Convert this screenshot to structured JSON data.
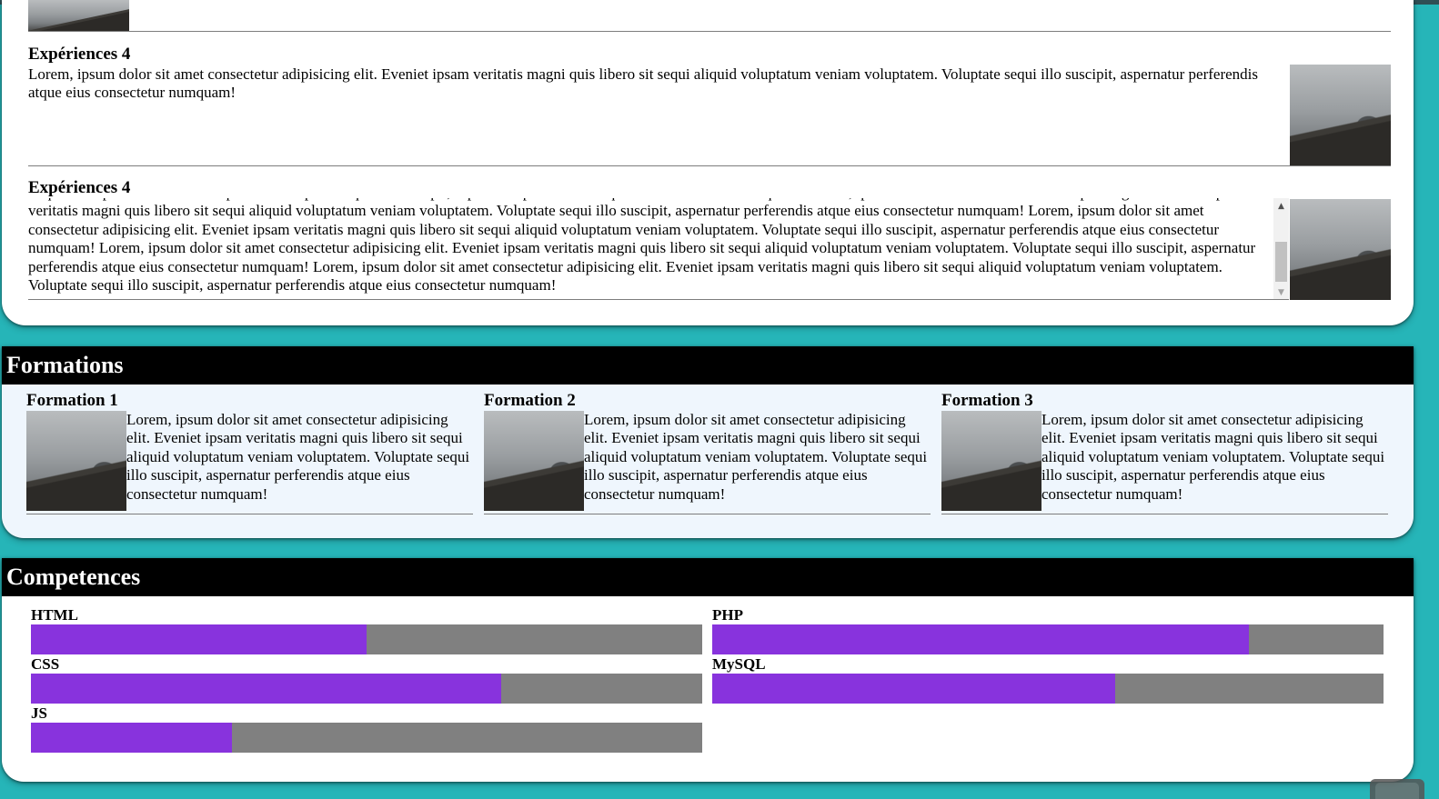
{
  "experiences": {
    "items": [
      {
        "title": "Expériences 4",
        "text": "Lorem, ipsum dolor sit amet consectetur adipisicing elit. Eveniet ipsam veritatis magni quis libero sit sequi aliquid voluptatum veniam voluptatem. Voluptate sequi illo suscipit, aspernatur perferendis atque eius consectetur numquam!"
      },
      {
        "title": "Expériences 4",
        "text": "aliquid voluptatum veniam voluptatem. Voluptate sequi illo suscipit, aspernatur perferendis atque eius consectetur numquam! Lorem, ipsum dolor sit amet consectetur adipisicing elit. Eveniet ipsam veritatis magni quis libero sit sequi aliquid voluptatum veniam voluptatem. Voluptate sequi illo suscipit, aspernatur perferendis atque eius consectetur numquam! Lorem, ipsum dolor sit amet consectetur adipisicing elit. Eveniet ipsam veritatis magni quis libero sit sequi aliquid voluptatum veniam voluptatem. Voluptate sequi illo suscipit, aspernatur perferendis atque eius consectetur numquam! Lorem, ipsum dolor sit amet consectetur adipisicing elit. Eveniet ipsam veritatis magni quis libero sit sequi aliquid voluptatum veniam voluptatem. Voluptate sequi illo suscipit, aspernatur perferendis atque eius consectetur numquam! Lorem, ipsum dolor sit amet consectetur adipisicing elit. Eveniet ipsam veritatis magni quis libero sit sequi aliquid voluptatum veniam voluptatem. Voluptate sequi illo suscipit, aspernatur perferendis atque eius consectetur numquam!"
      }
    ]
  },
  "formations": {
    "heading": "Formations",
    "items": [
      {
        "title": "Formation 1",
        "text": "Lorem, ipsum dolor sit amet consectetur adipisicing elit. Eveniet ipsam veritatis magni quis libero sit sequi aliquid voluptatum veniam voluptatem. Voluptate sequi illo suscipit, aspernatur perferendis atque eius consectetur numquam!"
      },
      {
        "title": "Formation 2",
        "text": "Lorem, ipsum dolor sit amet consectetur adipisicing elit. Eveniet ipsam veritatis magni quis libero sit sequi aliquid voluptatum veniam voluptatem. Voluptate sequi illo suscipit, aspernatur perferendis atque eius consectetur numquam!"
      },
      {
        "title": "Formation 3",
        "text": "Lorem, ipsum dolor sit amet consectetur adipisicing elit. Eveniet ipsam veritatis magni quis libero sit sequi aliquid voluptatum veniam voluptatem. Voluptate sequi illo suscipit, aspernatur perferendis atque eius consectetur numquam!"
      }
    ]
  },
  "competences": {
    "heading": "Competences",
    "skills": [
      {
        "name": "HTML",
        "level": 0.5
      },
      {
        "name": "PHP",
        "level": 0.8
      },
      {
        "name": "CSS",
        "level": 0.7
      },
      {
        "name": "MySQL",
        "level": 0.6
      },
      {
        "name": "JS",
        "level": 0.3
      }
    ]
  },
  "colors": {
    "page_background": "#26b5b8",
    "header_background": "#000000",
    "skill_fill": "#8833dd",
    "skill_track": "#808080",
    "formations_background": "#eff6fd"
  },
  "icons": {
    "scroll_up": "scroll-up-arrow-icon",
    "scroll_down": "scroll-down-arrow-icon"
  }
}
